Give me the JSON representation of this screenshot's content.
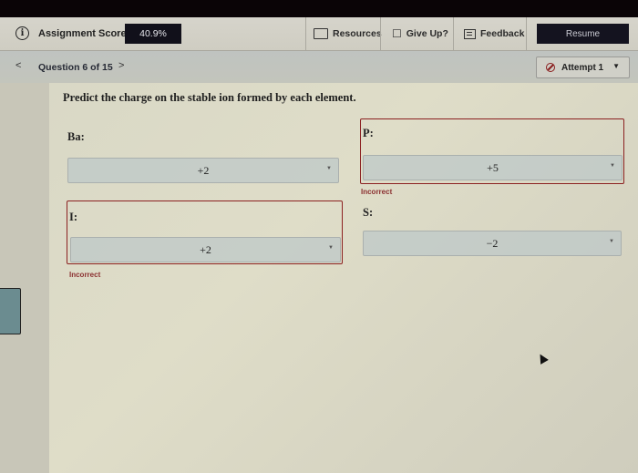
{
  "header": {
    "score_label": "Assignment Score:",
    "score_value": "40.9%",
    "resources_label": "Resources",
    "giveup_label": "Give Up?",
    "feedback_label": "Feedback",
    "resume_label": "Resume"
  },
  "subbar": {
    "prev": "<",
    "question_label": "Question 6 of 15",
    "next": ">",
    "attempt_label": "Attempt 1"
  },
  "question": {
    "prompt": "Predict the charge on the stable ion formed by each element.",
    "items": [
      {
        "element": "Ba:",
        "selected": "+2",
        "status": ""
      },
      {
        "element": "P:",
        "selected": "+5",
        "status": "Incorrect"
      },
      {
        "element": "I:",
        "selected": "+2",
        "status": "Incorrect"
      },
      {
        "element": "S:",
        "selected": "−2",
        "status": ""
      }
    ]
  },
  "colors": {
    "incorrect": "#8b2020",
    "dark_button": "#14131f"
  }
}
